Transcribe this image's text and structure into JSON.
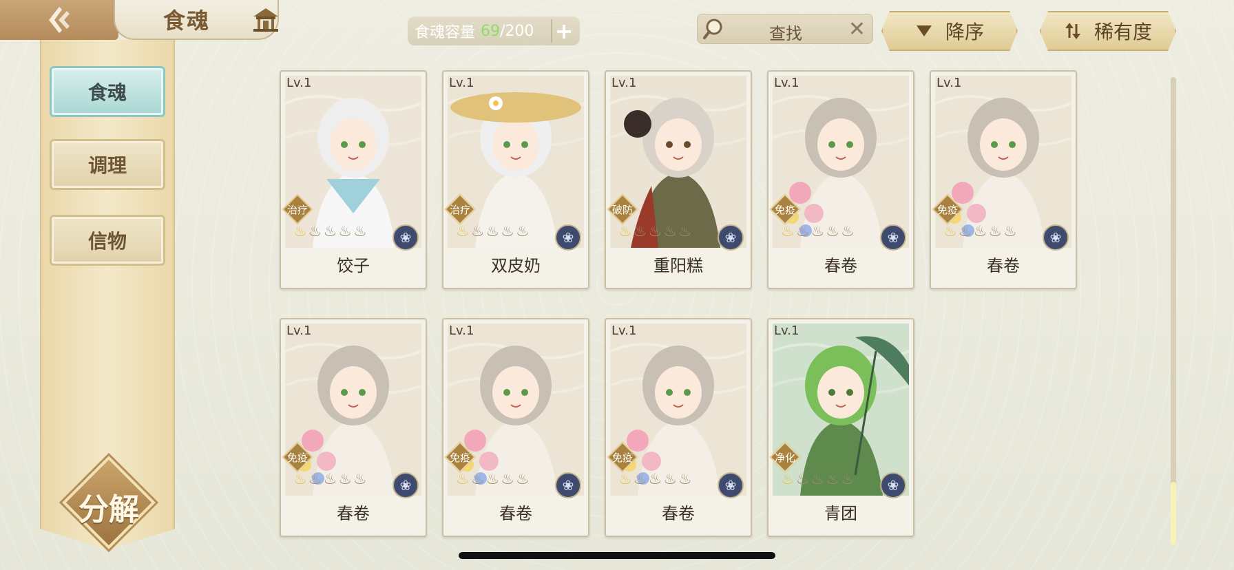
{
  "header": {
    "title": "食魂",
    "capacity_label": "食魂容量",
    "capacity_current": "69",
    "capacity_max": "/200",
    "capacity_add": "+",
    "search_label": "查找",
    "search_clear": "✕",
    "sort_order_label": "降序",
    "sort_rarity_label": "稀有度"
  },
  "sidebar": {
    "items": [
      {
        "label": "食魂",
        "active": true
      },
      {
        "label": "调理",
        "active": false
      },
      {
        "label": "信物",
        "active": false
      }
    ],
    "decompose_label": "分解"
  },
  "cards": [
    {
      "level": "Lv.1",
      "role": "治疗",
      "name": "饺子",
      "stars_on": 1,
      "stars_total": 5,
      "theme": "white"
    },
    {
      "level": "Lv.1",
      "role": "治疗",
      "name": "双皮奶",
      "stars_on": 1,
      "stars_total": 5,
      "theme": "straw"
    },
    {
      "level": "Lv.1",
      "role": "破防",
      "name": "重阳糕",
      "stars_on": 1,
      "stars_total": 5,
      "theme": "olive"
    },
    {
      "level": "Lv.1",
      "role": "免疫",
      "name": "春卷",
      "stars_on": 1,
      "stars_total": 5,
      "theme": "flower"
    },
    {
      "level": "Lv.1",
      "role": "免疫",
      "name": "春卷",
      "stars_on": 1,
      "stars_total": 5,
      "theme": "flower"
    },
    {
      "level": "Lv.1",
      "role": "免疫",
      "name": "春卷",
      "stars_on": 1,
      "stars_total": 5,
      "theme": "flower"
    },
    {
      "level": "Lv.1",
      "role": "免疫",
      "name": "春卷",
      "stars_on": 1,
      "stars_total": 5,
      "theme": "flower"
    },
    {
      "level": "Lv.1",
      "role": "免疫",
      "name": "春卷",
      "stars_on": 1,
      "stars_total": 5,
      "theme": "flower"
    },
    {
      "level": "Lv.1",
      "role": "净化",
      "name": "青团",
      "stars_on": 1,
      "stars_total": 5,
      "theme": "green"
    }
  ],
  "colors": {
    "accent_gold": "#c6ad74",
    "active_teal": "#a9d7d3",
    "capacity_green": "#8fdc6b",
    "role_badge": "#a9823f"
  }
}
